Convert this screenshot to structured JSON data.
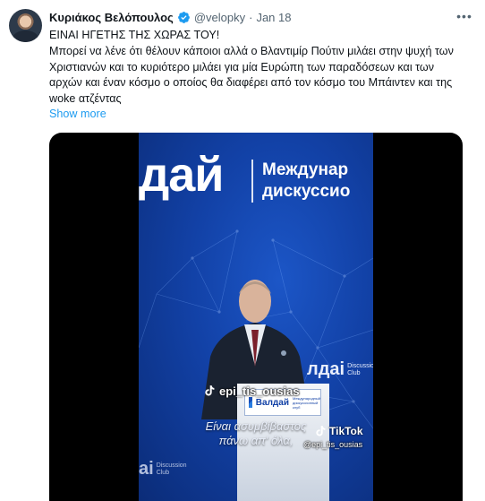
{
  "tweet": {
    "author_name": "Κυριάκος Βελόπουλος",
    "author_handle": "@velopky",
    "separator": "·",
    "date": "Jan 18",
    "more_icon": "ellipsis-icon",
    "verified_icon": "verified-badge-icon",
    "text_line_1": "ΕΙΝΑΙ ΗΓΕΤΗΣ ΤΗΣ ΧΩΡΑΣ ΤΟΥ!",
    "text_line_2": "Μπορεί να λένε ότι θέλουν κάποιοι αλλά ο Βλαντιμίρ Πούτιν μιλάει στην ψυχή των Χριστιανών και το κυριότερο μιλάει για μία Ευρώπη των παραδόσεων και των αρχών και έναν κόσμο ο οποίος θα διαφέρει από τον κόσμο του Μπάιντεν και της woke ατζέντας",
    "show_more": "Show more"
  },
  "video": {
    "backdrop_brand": "дай",
    "backdrop_sub_1": "Междунар",
    "backdrop_sub_2": "дискуссио",
    "side_logo_ai": "лдаі",
    "side_logo_dc_1": "Discussion",
    "side_logo_dc_2": "Club",
    "bottom_logo_ai": "аі",
    "bottom_logo_dc_1": "Discussion",
    "bottom_logo_dc_2": "Club",
    "podium_name": "Валдай",
    "podium_small": "Международный дискуссионный клуб",
    "tiktok_user": "epi_tis_ousias",
    "caption_1": "Είναι ασυμβίβαστος",
    "caption_2": "πάνω απ' όλα,",
    "tiktok_brand": "TikTok",
    "tiktok_handle": "@epi_tis_ousias",
    "colors": {
      "backdrop": "#1241a6",
      "accent": "#1d9bf0"
    }
  }
}
